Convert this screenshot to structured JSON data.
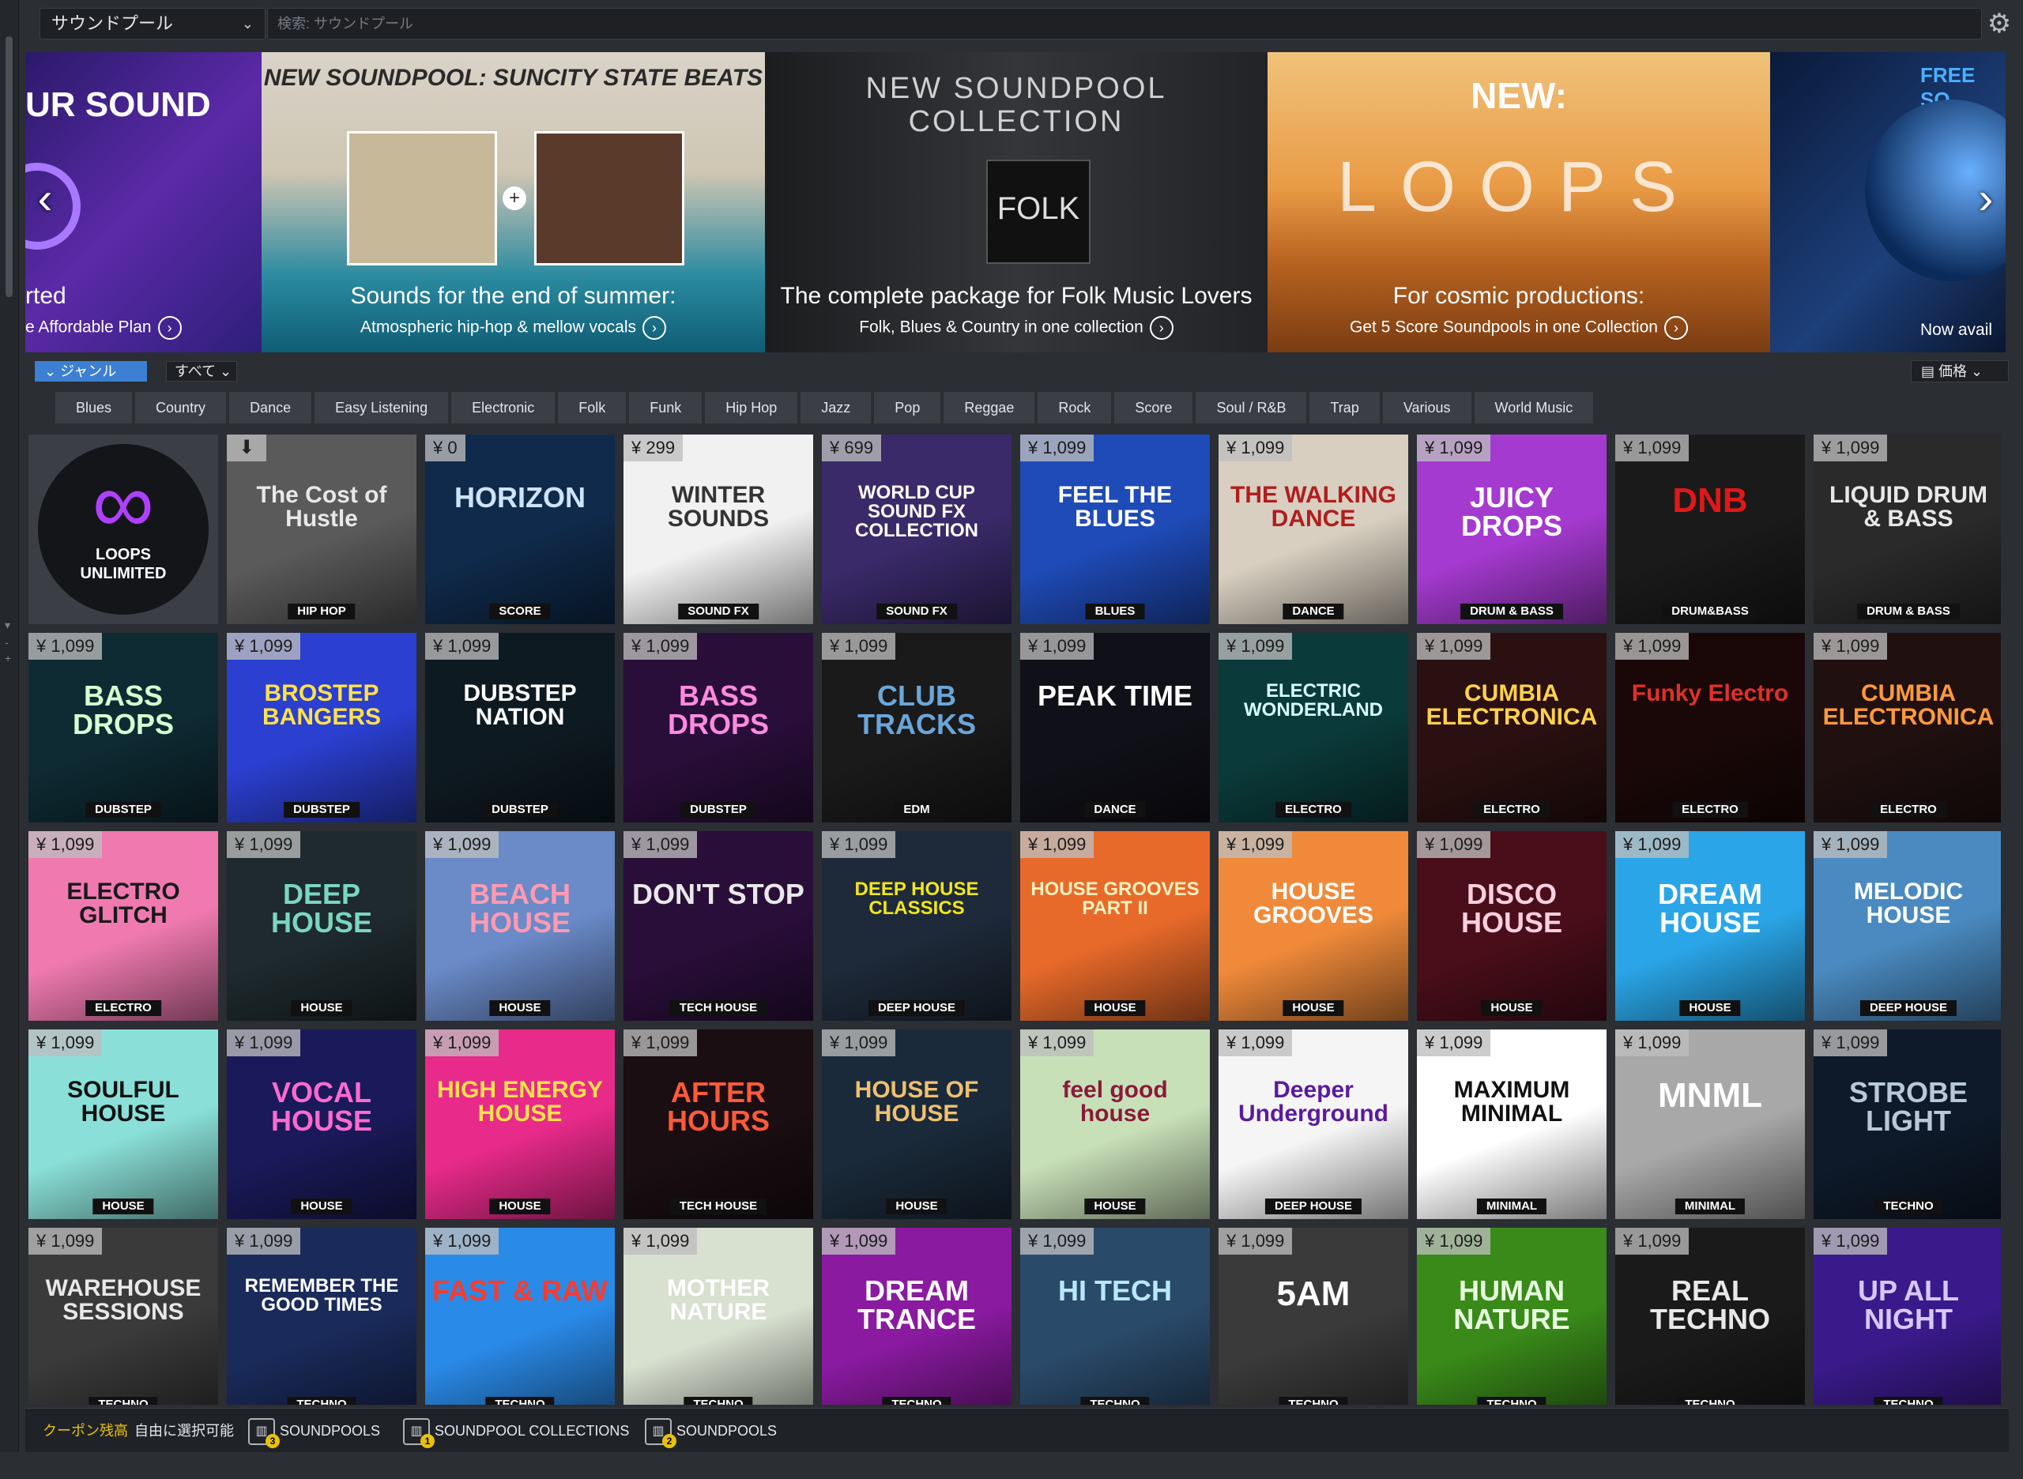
{
  "topbar": {
    "source_label": "サウンドプール",
    "search_placeholder": "検索: サウンドプール",
    "settings_icon": "gear-icon"
  },
  "banners": [
    {
      "title": "UR SOUND",
      "line1": "rted",
      "line2": "e Affordable Plan",
      "bg": "#4b2a9a"
    },
    {
      "title": "NEW SOUNDPOOL: SUNCITY STATE BEATS",
      "line1": "Sounds for the end of summer:",
      "line2": "Atmospheric hip-hop & mellow vocals",
      "bg": "#d9d3c8"
    },
    {
      "title": "NEW SOUNDPOOL COLLECTION",
      "line1": "The complete package for Folk Music Lovers",
      "line2": "Folk, Blues & Country in one collection",
      "bg": "#2a2b2e"
    },
    {
      "title": "NEW:",
      "line1": "For cosmic productions:",
      "line2": "Get 5 Score Soundpools in one Collection",
      "bg": "#e99b45"
    },
    {
      "title": "FREE SO",
      "line1": "",
      "line2": "Now avail",
      "bg": "#1d3f7a"
    }
  ],
  "filter": {
    "genre_label": "ジャンル",
    "all_label": "すべて",
    "sort_label": "価格"
  },
  "genres": [
    "Blues",
    "Country",
    "Dance",
    "Easy Listening",
    "Electronic",
    "Folk",
    "Funk",
    "Hip Hop",
    "Jazz",
    "Pop",
    "Reggae",
    "Rock",
    "Score",
    "Soul / R&B",
    "Trap",
    "Various",
    "World Music"
  ],
  "tiles": [
    {
      "price": "",
      "title": "LOOPS UNLIMITED",
      "genre": "",
      "bg": "#1d1f25",
      "fg": "#ffffff",
      "special": "loops"
    },
    {
      "price": "",
      "title": "The Cost of Hustle",
      "genre": "HIP HOP",
      "bg": "#5a5a5a",
      "fg": "#e8e8e8",
      "special": "download"
    },
    {
      "price": "¥ 0",
      "title": "HORIZON",
      "genre": "SCORE",
      "bg": "#0f2a4a",
      "fg": "#cfe3ff"
    },
    {
      "price": "¥ 299",
      "title": "WINTER SOUNDS",
      "genre": "SOUND FX",
      "bg": "#f1f1f1",
      "fg": "#333333"
    },
    {
      "price": "¥ 699",
      "title": "WORLD CUP SOUND FX COLLECTION",
      "genre": "SOUND FX",
      "bg": "#3a2a6a",
      "fg": "#ffffff"
    },
    {
      "price": "¥ 1,099",
      "title": "FEEL THE BLUES",
      "genre": "BLUES",
      "bg": "#1f4bb8",
      "fg": "#ffffff"
    },
    {
      "price": "¥ 1,099",
      "title": "THE WALKING DANCE",
      "genre": "DANCE",
      "bg": "#d8cfc0",
      "fg": "#b01e1e"
    },
    {
      "price": "¥ 1,099",
      "title": "JUICY DROPS",
      "genre": "DRUM & BASS",
      "bg": "#a53ad0",
      "fg": "#ffffff"
    },
    {
      "price": "¥ 1,099",
      "title": "DNB",
      "genre": "DRUM&BASS",
      "bg": "#1a1a1a",
      "fg": "#e01818"
    },
    {
      "price": "¥ 1,099",
      "title": "LIQUID DRUM & BASS",
      "genre": "DRUM & BASS",
      "bg": "#2a2a2a",
      "fg": "#e8e8e8"
    },
    {
      "price": "¥ 1,099",
      "title": "BASS DROPS",
      "genre": "DUBSTEP",
      "bg": "#0e2a33",
      "fg": "#d8ffd0"
    },
    {
      "price": "¥ 1,099",
      "title": "BROSTEP BANGERS",
      "genre": "DUBSTEP",
      "bg": "#2b3fd0",
      "fg": "#ffe24a"
    },
    {
      "price": "¥ 1,099",
      "title": "DUBSTEP NATION",
      "genre": "DUBSTEP",
      "bg": "#0e1a22",
      "fg": "#ffffff"
    },
    {
      "price": "¥ 1,099",
      "title": "BASS DROPS",
      "genre": "DUBSTEP",
      "bg": "#2a0e3a",
      "fg": "#ff8ae0"
    },
    {
      "price": "¥ 1,099",
      "title": "CLUB TRACKS",
      "genre": "EDM",
      "bg": "#1a1a1a",
      "fg": "#6aa6d8"
    },
    {
      "price": "¥ 1,099",
      "title": "PEAK TIME",
      "genre": "DANCE",
      "bg": "#101018",
      "fg": "#ffffff"
    },
    {
      "price": "¥ 1,099",
      "title": "ELECTRIC WONDERLAND",
      "genre": "ELECTRO",
      "bg": "#0b3a3a",
      "fg": "#d6ffff"
    },
    {
      "price": "¥ 1,099",
      "title": "CUMBIA ELECTRONICA",
      "genre": "ELECTRO",
      "bg": "#2a1010",
      "fg": "#ffd14a"
    },
    {
      "price": "¥ 1,099",
      "title": "Funky Electro",
      "genre": "ELECTRO",
      "bg": "#1a0808",
      "fg": "#e0302a"
    },
    {
      "price": "¥ 1,099",
      "title": "CUMBIA ELECTRONICA",
      "genre": "ELECTRO",
      "bg": "#201010",
      "fg": "#ff9a3a"
    },
    {
      "price": "¥ 1,099",
      "title": "ELECTRO GLITCH",
      "genre": "ELECTRO",
      "bg": "#f07ab0",
      "fg": "#1a1a1a"
    },
    {
      "price": "¥ 1,099",
      "title": "DEEP HOUSE",
      "genre": "HOUSE",
      "bg": "#1e2a2e",
      "fg": "#7ad6c0"
    },
    {
      "price": "¥ 1,099",
      "title": "BEACH HOUSE",
      "genre": "HOUSE",
      "bg": "#6a8ac8",
      "fg": "#ff9ab0"
    },
    {
      "price": "¥ 1,099",
      "title": "DON'T STOP",
      "genre": "TECH HOUSE",
      "bg": "#2a0e3a",
      "fg": "#e8e8e8"
    },
    {
      "price": "¥ 1,099",
      "title": "DEEP HOUSE CLASSICS",
      "genre": "DEEP HOUSE",
      "bg": "#1e2a3a",
      "fg": "#f2e61a"
    },
    {
      "price": "¥ 1,099",
      "title": "HOUSE GROOVES PART II",
      "genre": "HOUSE",
      "bg": "#e86a2a",
      "fg": "#fff2c0"
    },
    {
      "price": "¥ 1,099",
      "title": "HOUSE GROOVES",
      "genre": "HOUSE",
      "bg": "#f08a3a",
      "fg": "#ffffff"
    },
    {
      "price": "¥ 1,099",
      "title": "DISCO HOUSE",
      "genre": "HOUSE",
      "bg": "#4a0e1a",
      "fg": "#ffd0e0"
    },
    {
      "price": "¥ 1,099",
      "title": "DREAM HOUSE",
      "genre": "HOUSE",
      "bg": "#2aa6e8",
      "fg": "#ffffff"
    },
    {
      "price": "¥ 1,099",
      "title": "MELODIC HOUSE",
      "genre": "DEEP HOUSE",
      "bg": "#4a8ac0",
      "fg": "#ffffff"
    },
    {
      "price": "¥ 1,099",
      "title": "SOULFUL HOUSE",
      "genre": "HOUSE",
      "bg": "#8ae0d8",
      "fg": "#111111"
    },
    {
      "price": "¥ 1,099",
      "title": "VOCAL HOUSE",
      "genre": "HOUSE",
      "bg": "#1a1a5a",
      "fg": "#ff6ad0"
    },
    {
      "price": "¥ 1,099",
      "title": "HIGH ENERGY HOUSE",
      "genre": "HOUSE",
      "bg": "#e82a8a",
      "fg": "#ffe24a"
    },
    {
      "price": "¥ 1,099",
      "title": "AFTER HOURS",
      "genre": "TECH HOUSE",
      "bg": "#1a0e12",
      "fg": "#ff5a3a"
    },
    {
      "price": "¥ 1,099",
      "title": "HOUSE OF HOUSE",
      "genre": "HOUSE",
      "bg": "#1a2a3a",
      "fg": "#f0c070"
    },
    {
      "price": "¥ 1,099",
      "title": "feel good house",
      "genre": "HOUSE",
      "bg": "#c8e0b8",
      "fg": "#8a1a3a"
    },
    {
      "price": "¥ 1,099",
      "title": "Deeper Underground",
      "genre": "DEEP HOUSE",
      "bg": "#f5f5f5",
      "fg": "#5a1aa0"
    },
    {
      "price": "¥ 1,099",
      "title": "MAXIMUM MINIMAL",
      "genre": "MINIMAL",
      "bg": "#ffffff",
      "fg": "#111111"
    },
    {
      "price": "¥ 1,099",
      "title": "MNML",
      "genre": "MINIMAL",
      "bg": "#a8a8a8",
      "fg": "#ffffff"
    },
    {
      "price": "¥ 1,099",
      "title": "STROBE LIGHT",
      "genre": "TECHNO",
      "bg": "#0e1a2a",
      "fg": "#b8c8d8"
    },
    {
      "price": "¥ 1,099",
      "title": "WAREHOUSE SESSIONS",
      "genre": "TECHNO",
      "bg": "#3a3a3a",
      "fg": "#e8e8e8"
    },
    {
      "price": "¥ 1,099",
      "title": "REMEMBER THE GOOD TIMES",
      "genre": "TECHNO",
      "bg": "#1a2a5a",
      "fg": "#ffffff"
    },
    {
      "price": "¥ 1,099",
      "title": "FAST & RAW",
      "genre": "TECHNO",
      "bg": "#2a8ae8",
      "fg": "#ff3a2a"
    },
    {
      "price": "¥ 1,099",
      "title": "MOTHER NATURE",
      "genre": "TECHNO",
      "bg": "#d8e0d0",
      "fg": "#ffffff"
    },
    {
      "price": "¥ 1,099",
      "title": "DREAM TRANCE",
      "genre": "TECHNO",
      "bg": "#8a1aa0",
      "fg": "#ffffff"
    },
    {
      "price": "¥ 1,099",
      "title": "HI TECH",
      "genre": "TECHNO",
      "bg": "#2a4a6a",
      "fg": "#b8e8ff"
    },
    {
      "price": "¥ 1,099",
      "title": "5AM",
      "genre": "TECHNO",
      "bg": "#3a3a3a",
      "fg": "#ffffff"
    },
    {
      "price": "¥ 1,099",
      "title": "HUMAN NATURE",
      "genre": "TECHNO",
      "bg": "#3a8a1a",
      "fg": "#e8ffe0"
    },
    {
      "price": "¥ 1,099",
      "title": "REAL TECHNO",
      "genre": "TECHNO",
      "bg": "#1a1a1a",
      "fg": "#e8e8e8"
    },
    {
      "price": "¥ 1,099",
      "title": "UP ALL NIGHT",
      "genre": "TECHNO",
      "bg": "#3a1a8a",
      "fg": "#d8c8ff"
    }
  ],
  "bottombar": {
    "coupon_label": "クーポン残高",
    "free_select_label": "自由に選択可能",
    "items": [
      {
        "count": "3",
        "label": "SOUNDPOOLS"
      },
      {
        "count": "1",
        "label": "SOUNDPOOL COLLECTIONS"
      },
      {
        "count": "2",
        "label": "SOUNDPOOLS"
      }
    ]
  }
}
